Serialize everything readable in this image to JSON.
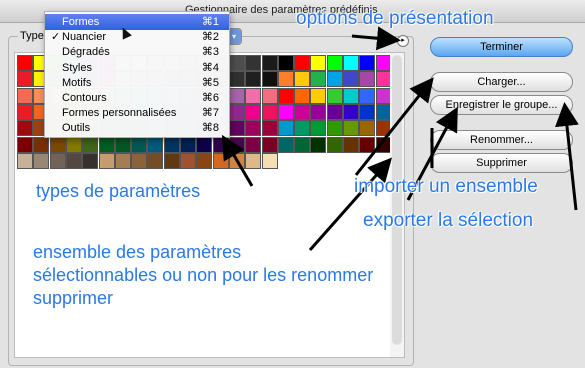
{
  "window": {
    "title": "Gestionnaire des paramètres prédéfinis"
  },
  "type_label": "Type :",
  "type_menu": {
    "items": [
      {
        "label": "Formes",
        "shortcut": "⌘1",
        "selected": true,
        "checked": false
      },
      {
        "label": "Nuancier",
        "shortcut": "⌘2",
        "selected": false,
        "checked": true
      },
      {
        "label": "Dégradés",
        "shortcut": "⌘3",
        "selected": false,
        "checked": false
      },
      {
        "label": "Styles",
        "shortcut": "⌘4",
        "selected": false,
        "checked": false
      },
      {
        "label": "Motifs",
        "shortcut": "⌘5",
        "selected": false,
        "checked": false
      },
      {
        "label": "Contours",
        "shortcut": "⌘6",
        "selected": false,
        "checked": false
      },
      {
        "label": "Formes personnalisées",
        "shortcut": "⌘7",
        "selected": false,
        "checked": false
      },
      {
        "label": "Outils",
        "shortcut": "⌘8",
        "selected": false,
        "checked": false
      }
    ],
    "check_mark": "✓"
  },
  "buttons": {
    "done": "Terminer",
    "load": "Charger...",
    "save_set": "Enregistrer le groupe...",
    "rename": "Renommer...",
    "delete": "Supprimer"
  },
  "annotations": {
    "options": "options de présentation",
    "types": "types de paramètres",
    "import": "importer un ensemble",
    "export": "exporter la sélection",
    "set_line1": "ensemble des paramètres",
    "set_line2": "sélectionnables ou non pour les renommer",
    "set_line3": "supprimer"
  },
  "swatch_rows": [
    [
      "#ff0000",
      "#ffff00",
      "#00ff00",
      "#00ffff",
      "#0000ff",
      "#ff00ff",
      "#ffffff",
      "#e6e6e6",
      "#cccccc",
      "#b3b3b3",
      "#999999",
      "#808080",
      "#666666",
      "#4d4d4d",
      "#333333",
      "#1a1a1a",
      "#000000",
      "#ff0000",
      "#ffff00",
      "#00ff00",
      "#00ffff",
      "#0000ff",
      "#ff00ff"
    ],
    [
      "#ed1c24",
      "#fff200",
      "#00a651",
      "#00aeef",
      "#2e3192",
      "#ec008c",
      "#c0c0c0",
      "#a0a0a0",
      "#808080",
      "#707070",
      "#606060",
      "#505050",
      "#404040",
      "#303030",
      "#202020",
      "#101010",
      "#ff7f27",
      "#ffc90e",
      "#22b14c",
      "#00a2e8",
      "#3f48cc",
      "#a349a4",
      "#ff3399"
    ],
    [
      "#f26c4f",
      "#f68e56",
      "#fbaf5d",
      "#fff568",
      "#acd373",
      "#7cc576",
      "#3bb878",
      "#1abbb4",
      "#00bff3",
      "#438ccb",
      "#5574b9",
      "#605ca8",
      "#855fa8",
      "#a763a8",
      "#f06ea9",
      "#f26d7d",
      "#ff0000",
      "#ff6600",
      "#ffcc00",
      "#33cc33",
      "#00cccc",
      "#3366ff",
      "#cc33cc"
    ],
    [
      "#ed1c24",
      "#f26522",
      "#f7941d",
      "#fff200",
      "#8dc63f",
      "#39b54a",
      "#00a651",
      "#00a99d",
      "#00aeef",
      "#0072bc",
      "#0054a6",
      "#2e3192",
      "#662d91",
      "#92278f",
      "#ec008c",
      "#ed145b",
      "#ff00ff",
      "#cc0099",
      "#990099",
      "#660099",
      "#3300cc",
      "#0033cc",
      "#006699"
    ],
    [
      "#9e0b0f",
      "#a0410d",
      "#a36209",
      "#aba000",
      "#598527",
      "#1a7b30",
      "#007236",
      "#00746b",
      "#0076a3",
      "#004b80",
      "#003471",
      "#1b1464",
      "#440e62",
      "#630460",
      "#9e005d",
      "#9e0039",
      "#0099cc",
      "#009966",
      "#009933",
      "#339900",
      "#669900",
      "#996600",
      "#993300"
    ],
    [
      "#790000",
      "#7b2e00",
      "#7d4900",
      "#827b00",
      "#406618",
      "#005e20",
      "#005826",
      "#005952",
      "#005b7f",
      "#003663",
      "#002157",
      "#0d004c",
      "#32004b",
      "#4b0049",
      "#7b0046",
      "#7a0026",
      "#006666",
      "#006633",
      "#003300",
      "#336600",
      "#663300",
      "#660000",
      "#330000"
    ],
    [
      "#c7b299",
      "#998675",
      "#736357",
      "#534741",
      "#37302d",
      "#c69c6d",
      "#a67c52",
      "#8c6239",
      "#754c24",
      "#603913",
      "#a0522d",
      "#8b4513",
      "#d2691e",
      "#cd853f",
      "#deb887",
      "#f5deb3"
    ]
  ]
}
